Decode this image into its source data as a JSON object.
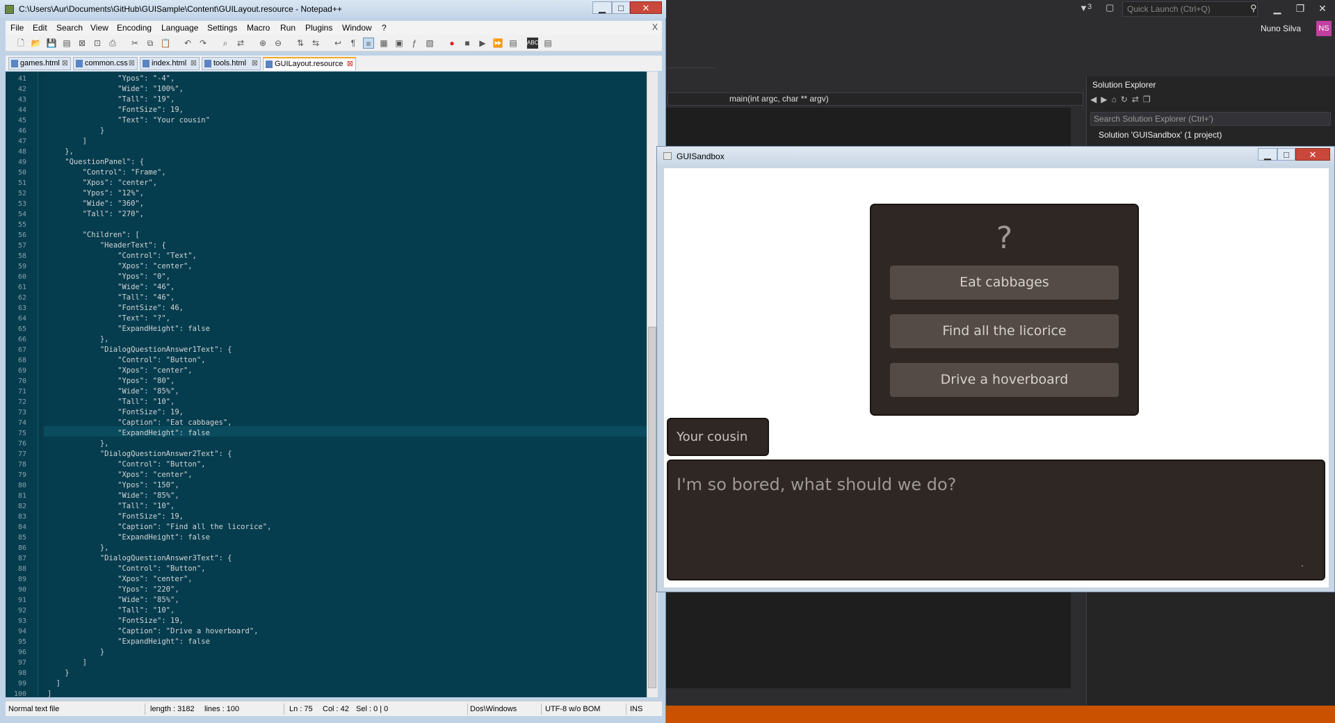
{
  "vs": {
    "filter_count": "3",
    "quick_launch_placeholder": "Quick Launch (Ctrl+Q)",
    "user_name": "Nuno Silva",
    "user_initials": "NS",
    "nav_function": "main(int argc, char ** argv)",
    "solution_explorer": {
      "title": "Solution Explorer",
      "search_placeholder": "Search Solution Explorer (Ctrl+')",
      "solution_item": "Solution 'GUISandbox' (1 project)"
    },
    "status_color": "#ca5100"
  },
  "npp": {
    "title": "C:\\Users\\Aur\\Documents\\GitHub\\GUISample\\Content\\GUILayout.resource - Notepad++",
    "menu": [
      "File",
      "Edit",
      "Search",
      "View",
      "Encoding",
      "Language",
      "Settings",
      "Macro",
      "Run",
      "Plugins",
      "Window",
      "?"
    ],
    "menu_close": "X",
    "tabs": [
      "games.html",
      "common.css",
      "index.html",
      "tools.html",
      "GUILayout.resource"
    ],
    "active_tab": "GUILayout.resource",
    "code_lines": [
      {
        "n": "41",
        "t": "                \"Ypos\": \"-4\","
      },
      {
        "n": "42",
        "t": "                \"Wide\": \"100%\","
      },
      {
        "n": "43",
        "t": "                \"Tall\": \"19\","
      },
      {
        "n": "44",
        "t": "                \"FontSize\": 19,"
      },
      {
        "n": "45",
        "t": "                \"Text\": \"Your cousin\""
      },
      {
        "n": "46",
        "t": "            }"
      },
      {
        "n": "47",
        "t": "        ]"
      },
      {
        "n": "48",
        "t": "    },"
      },
      {
        "n": "49",
        "t": "    \"QuestionPanel\": {"
      },
      {
        "n": "50",
        "t": "        \"Control\": \"Frame\","
      },
      {
        "n": "51",
        "t": "        \"Xpos\": \"center\","
      },
      {
        "n": "52",
        "t": "        \"Ypos\": \"12%\","
      },
      {
        "n": "53",
        "t": "        \"Wide\": \"360\","
      },
      {
        "n": "54",
        "t": "        \"Tall\": \"270\","
      },
      {
        "n": "55",
        "t": ""
      },
      {
        "n": "56",
        "t": "        \"Children\": ["
      },
      {
        "n": "57",
        "t": "            \"HeaderText\": {"
      },
      {
        "n": "58",
        "t": "                \"Control\": \"Text\","
      },
      {
        "n": "59",
        "t": "                \"Xpos\": \"center\","
      },
      {
        "n": "60",
        "t": "                \"Ypos\": \"0\","
      },
      {
        "n": "61",
        "t": "                \"Wide\": \"46\","
      },
      {
        "n": "62",
        "t": "                \"Tall\": \"46\","
      },
      {
        "n": "63",
        "t": "                \"FontSize\": 46,"
      },
      {
        "n": "64",
        "t": "                \"Text\": \"?\","
      },
      {
        "n": "65",
        "t": "                \"ExpandHeight\": false"
      },
      {
        "n": "66",
        "t": "            },"
      },
      {
        "n": "67",
        "t": "            \"DialogQuestionAnswer1Text\": {"
      },
      {
        "n": "68",
        "t": "                \"Control\": \"Button\","
      },
      {
        "n": "69",
        "t": "                \"Xpos\": \"center\","
      },
      {
        "n": "70",
        "t": "                \"Ypos\": \"80\","
      },
      {
        "n": "71",
        "t": "                \"Wide\": \"85%\","
      },
      {
        "n": "72",
        "t": "                \"Tall\": \"10\","
      },
      {
        "n": "73",
        "t": "                \"FontSize\": 19,"
      },
      {
        "n": "74",
        "t": "                \"Caption\": \"Eat cabbages\","
      },
      {
        "n": "75",
        "t": "                \"ExpandHeight\": false"
      },
      {
        "n": "76",
        "t": "            },"
      },
      {
        "n": "77",
        "t": "            \"DialogQuestionAnswer2Text\": {"
      },
      {
        "n": "78",
        "t": "                \"Control\": \"Button\","
      },
      {
        "n": "79",
        "t": "                \"Xpos\": \"center\","
      },
      {
        "n": "80",
        "t": "                \"Ypos\": \"150\","
      },
      {
        "n": "81",
        "t": "                \"Wide\": \"85%\","
      },
      {
        "n": "82",
        "t": "                \"Tall\": \"10\","
      },
      {
        "n": "83",
        "t": "                \"FontSize\": 19,"
      },
      {
        "n": "84",
        "t": "                \"Caption\": \"Find all the licorice\","
      },
      {
        "n": "85",
        "t": "                \"ExpandHeight\": false"
      },
      {
        "n": "86",
        "t": "            },"
      },
      {
        "n": "87",
        "t": "            \"DialogQuestionAnswer3Text\": {"
      },
      {
        "n": "88",
        "t": "                \"Control\": \"Button\","
      },
      {
        "n": "89",
        "t": "                \"Xpos\": \"center\","
      },
      {
        "n": "90",
        "t": "                \"Ypos\": \"220\","
      },
      {
        "n": "91",
        "t": "                \"Wide\": \"85%\","
      },
      {
        "n": "92",
        "t": "                \"Tall\": \"10\","
      },
      {
        "n": "93",
        "t": "                \"FontSize\": 19,"
      },
      {
        "n": "94",
        "t": "                \"Caption\": \"Drive a hoverboard\","
      },
      {
        "n": "95",
        "t": "                \"ExpandHeight\": false"
      },
      {
        "n": "96",
        "t": "            }"
      },
      {
        "n": "97",
        "t": "        ]"
      },
      {
        "n": "98",
        "t": "    }"
      },
      {
        "n": "99",
        "t": "  ]"
      },
      {
        "n": "100",
        "t": "]"
      }
    ],
    "status": {
      "file_type": "Normal text file",
      "length": "length : 3182",
      "lines": "lines : 100",
      "ln": "Ln : 75",
      "col": "Col : 42",
      "sel": "Sel : 0 | 0",
      "eol": "Dos\\Windows",
      "encoding": "UTF-8 w/o BOM",
      "mode": "INS"
    },
    "editor_bg": "#053d4f"
  },
  "gui": {
    "title": "GUISandbox",
    "header_text": "?",
    "answers": [
      "Eat cabbages",
      "Find all the licorice",
      "Drive a hoverboard"
    ],
    "speaker": "Your cousin",
    "dialog_text": "I'm so bored, what should we do?",
    "panel_color": "#2e2723",
    "button_color": "#554b46"
  }
}
